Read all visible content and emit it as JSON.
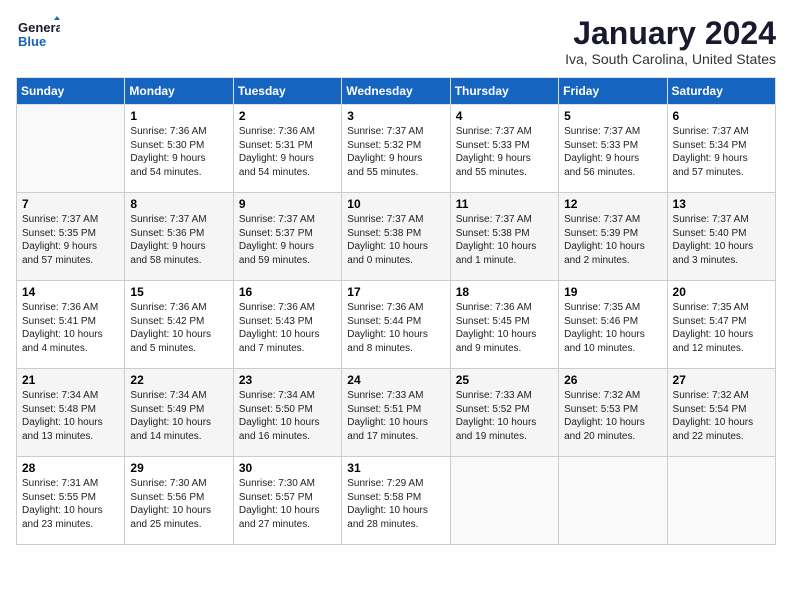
{
  "logo": {
    "line1": "General",
    "line2": "Blue"
  },
  "title": "January 2024",
  "location": "Iva, South Carolina, United States",
  "days_header": [
    "Sunday",
    "Monday",
    "Tuesday",
    "Wednesday",
    "Thursday",
    "Friday",
    "Saturday"
  ],
  "weeks": [
    [
      {
        "num": "",
        "text": ""
      },
      {
        "num": "1",
        "text": "Sunrise: 7:36 AM\nSunset: 5:30 PM\nDaylight: 9 hours\nand 54 minutes."
      },
      {
        "num": "2",
        "text": "Sunrise: 7:36 AM\nSunset: 5:31 PM\nDaylight: 9 hours\nand 54 minutes."
      },
      {
        "num": "3",
        "text": "Sunrise: 7:37 AM\nSunset: 5:32 PM\nDaylight: 9 hours\nand 55 minutes."
      },
      {
        "num": "4",
        "text": "Sunrise: 7:37 AM\nSunset: 5:33 PM\nDaylight: 9 hours\nand 55 minutes."
      },
      {
        "num": "5",
        "text": "Sunrise: 7:37 AM\nSunset: 5:33 PM\nDaylight: 9 hours\nand 56 minutes."
      },
      {
        "num": "6",
        "text": "Sunrise: 7:37 AM\nSunset: 5:34 PM\nDaylight: 9 hours\nand 57 minutes."
      }
    ],
    [
      {
        "num": "7",
        "text": "Sunrise: 7:37 AM\nSunset: 5:35 PM\nDaylight: 9 hours\nand 57 minutes."
      },
      {
        "num": "8",
        "text": "Sunrise: 7:37 AM\nSunset: 5:36 PM\nDaylight: 9 hours\nand 58 minutes."
      },
      {
        "num": "9",
        "text": "Sunrise: 7:37 AM\nSunset: 5:37 PM\nDaylight: 9 hours\nand 59 minutes."
      },
      {
        "num": "10",
        "text": "Sunrise: 7:37 AM\nSunset: 5:38 PM\nDaylight: 10 hours\nand 0 minutes."
      },
      {
        "num": "11",
        "text": "Sunrise: 7:37 AM\nSunset: 5:38 PM\nDaylight: 10 hours\nand 1 minute."
      },
      {
        "num": "12",
        "text": "Sunrise: 7:37 AM\nSunset: 5:39 PM\nDaylight: 10 hours\nand 2 minutes."
      },
      {
        "num": "13",
        "text": "Sunrise: 7:37 AM\nSunset: 5:40 PM\nDaylight: 10 hours\nand 3 minutes."
      }
    ],
    [
      {
        "num": "14",
        "text": "Sunrise: 7:36 AM\nSunset: 5:41 PM\nDaylight: 10 hours\nand 4 minutes."
      },
      {
        "num": "15",
        "text": "Sunrise: 7:36 AM\nSunset: 5:42 PM\nDaylight: 10 hours\nand 5 minutes."
      },
      {
        "num": "16",
        "text": "Sunrise: 7:36 AM\nSunset: 5:43 PM\nDaylight: 10 hours\nand 7 minutes."
      },
      {
        "num": "17",
        "text": "Sunrise: 7:36 AM\nSunset: 5:44 PM\nDaylight: 10 hours\nand 8 minutes."
      },
      {
        "num": "18",
        "text": "Sunrise: 7:36 AM\nSunset: 5:45 PM\nDaylight: 10 hours\nand 9 minutes."
      },
      {
        "num": "19",
        "text": "Sunrise: 7:35 AM\nSunset: 5:46 PM\nDaylight: 10 hours\nand 10 minutes."
      },
      {
        "num": "20",
        "text": "Sunrise: 7:35 AM\nSunset: 5:47 PM\nDaylight: 10 hours\nand 12 minutes."
      }
    ],
    [
      {
        "num": "21",
        "text": "Sunrise: 7:34 AM\nSunset: 5:48 PM\nDaylight: 10 hours\nand 13 minutes."
      },
      {
        "num": "22",
        "text": "Sunrise: 7:34 AM\nSunset: 5:49 PM\nDaylight: 10 hours\nand 14 minutes."
      },
      {
        "num": "23",
        "text": "Sunrise: 7:34 AM\nSunset: 5:50 PM\nDaylight: 10 hours\nand 16 minutes."
      },
      {
        "num": "24",
        "text": "Sunrise: 7:33 AM\nSunset: 5:51 PM\nDaylight: 10 hours\nand 17 minutes."
      },
      {
        "num": "25",
        "text": "Sunrise: 7:33 AM\nSunset: 5:52 PM\nDaylight: 10 hours\nand 19 minutes."
      },
      {
        "num": "26",
        "text": "Sunrise: 7:32 AM\nSunset: 5:53 PM\nDaylight: 10 hours\nand 20 minutes."
      },
      {
        "num": "27",
        "text": "Sunrise: 7:32 AM\nSunset: 5:54 PM\nDaylight: 10 hours\nand 22 minutes."
      }
    ],
    [
      {
        "num": "28",
        "text": "Sunrise: 7:31 AM\nSunset: 5:55 PM\nDaylight: 10 hours\nand 23 minutes."
      },
      {
        "num": "29",
        "text": "Sunrise: 7:30 AM\nSunset: 5:56 PM\nDaylight: 10 hours\nand 25 minutes."
      },
      {
        "num": "30",
        "text": "Sunrise: 7:30 AM\nSunset: 5:57 PM\nDaylight: 10 hours\nand 27 minutes."
      },
      {
        "num": "31",
        "text": "Sunrise: 7:29 AM\nSunset: 5:58 PM\nDaylight: 10 hours\nand 28 minutes."
      },
      {
        "num": "",
        "text": ""
      },
      {
        "num": "",
        "text": ""
      },
      {
        "num": "",
        "text": ""
      }
    ]
  ]
}
